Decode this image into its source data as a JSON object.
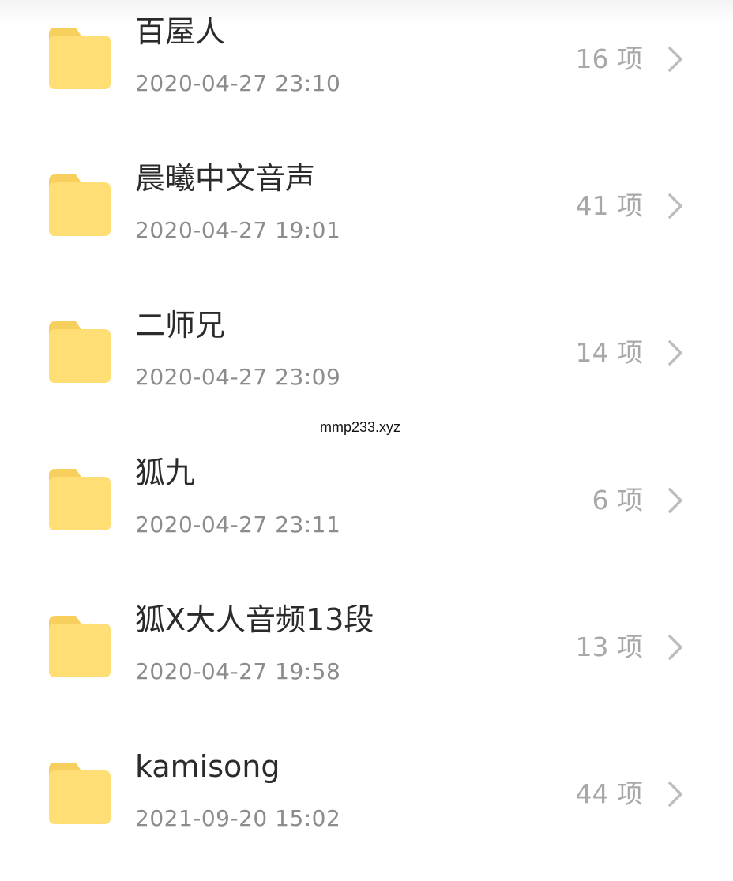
{
  "colors": {
    "folder_body": "#FFDE75",
    "folder_tab": "#F6CF5C",
    "title_text": "#2b2b2b",
    "meta_text": "#8c8c8c",
    "count_text": "#a8a8a8"
  },
  "watermark": "mmp233.xyz",
  "folders": [
    {
      "name": "百屋人",
      "date": "2020-04-27 23:10",
      "count": "16 项",
      "icon": "folder-icon"
    },
    {
      "name": "晨曦中文音声",
      "date": "2020-04-27 19:01",
      "count": "41 项",
      "icon": "folder-icon"
    },
    {
      "name": "二师兄",
      "date": "2020-04-27 23:09",
      "count": "14 项",
      "icon": "folder-icon"
    },
    {
      "name": "狐九",
      "date": "2020-04-27 23:11",
      "count": "6 项",
      "icon": "folder-icon"
    },
    {
      "name": "狐X大人音频13段",
      "date": "2020-04-27 19:58",
      "count": "13 项",
      "icon": "folder-icon"
    },
    {
      "name": "kamisong",
      "date": "2021-09-20 15:02",
      "count": "44 项",
      "icon": "folder-icon"
    }
  ]
}
